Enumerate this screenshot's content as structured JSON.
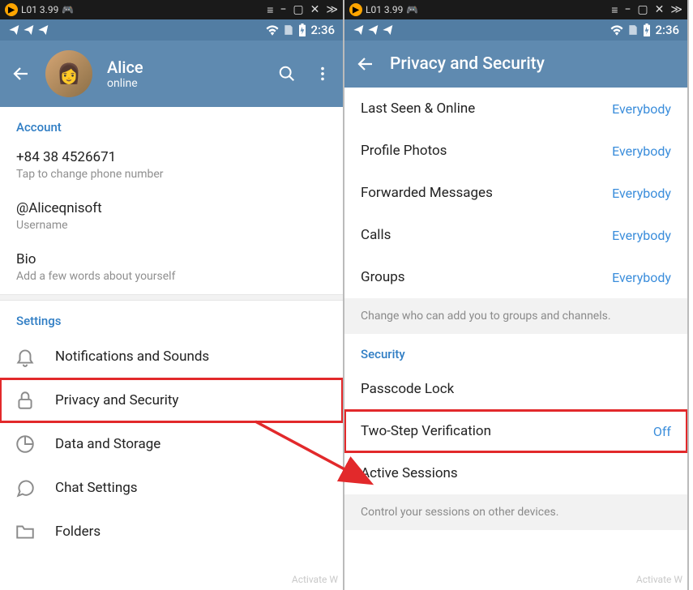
{
  "emulator": {
    "label": "L01 3.99",
    "icons": [
      "≡",
      "−",
      "▢",
      "✕",
      "≫"
    ]
  },
  "status": {
    "time": "2:36"
  },
  "left": {
    "profile": {
      "name": "Alice",
      "status": "online"
    },
    "account": {
      "header": "Account",
      "phone": "+84 38 4526671",
      "phone_hint": "Tap to change phone number",
      "username": "@Aliceqnisoft",
      "username_hint": "Username",
      "bio": "Bio",
      "bio_hint": "Add a few words about yourself"
    },
    "settings": {
      "header": "Settings",
      "items": [
        "Notifications and Sounds",
        "Privacy and Security",
        "Data and Storage",
        "Chat Settings",
        "Folders"
      ]
    }
  },
  "right": {
    "title": "Privacy and Security",
    "privacy": [
      {
        "label": "Last Seen & Online",
        "value": "Everybody"
      },
      {
        "label": "Profile Photos",
        "value": "Everybody"
      },
      {
        "label": "Forwarded Messages",
        "value": "Everybody"
      },
      {
        "label": "Calls",
        "value": "Everybody"
      },
      {
        "label": "Groups",
        "value": "Everybody"
      }
    ],
    "privacy_hint": "Change who can add you to groups and channels.",
    "security": {
      "header": "Security",
      "items": [
        {
          "label": "Passcode Lock",
          "value": ""
        },
        {
          "label": "Two-Step Verification",
          "value": "Off"
        },
        {
          "label": "Active Sessions",
          "value": ""
        }
      ],
      "hint": "Control your sessions on other devices."
    }
  },
  "watermark": "Activate W"
}
